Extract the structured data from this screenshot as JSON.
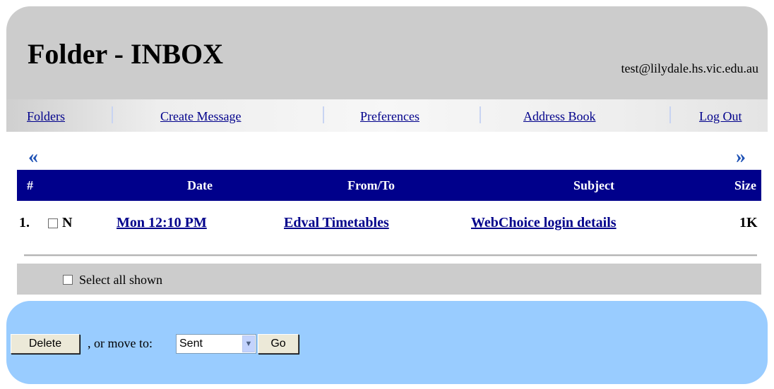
{
  "header": {
    "title": "Folder - INBOX",
    "user_email": "test@lilydale.hs.vic.edu.au"
  },
  "nav": {
    "folders": "Folders",
    "create_message": "Create Message",
    "preferences": "Preferences",
    "address_book": "Address Book",
    "log_out": "Log Out"
  },
  "pager": {
    "prev": "«",
    "next": "»"
  },
  "table": {
    "columns": {
      "num": "#",
      "date": "Date",
      "from_to": "From/To",
      "subject": "Subject",
      "size": "Size"
    },
    "rows": [
      {
        "num": "1.",
        "flag": "N",
        "date": "Mon 12:10 PM",
        "from": "Edval Timetables",
        "subject": "WebChoice login details",
        "size": "1K"
      }
    ]
  },
  "select_all_label": "Select all shown",
  "actions": {
    "delete_label": "Delete",
    "move_text": ", or move to:",
    "move_target": "Sent",
    "go_label": "Go"
  },
  "colors": {
    "header_bg": "#cccccc",
    "table_header_bg": "#00008b",
    "link": "#00008b",
    "action_bg": "#99ccff"
  }
}
